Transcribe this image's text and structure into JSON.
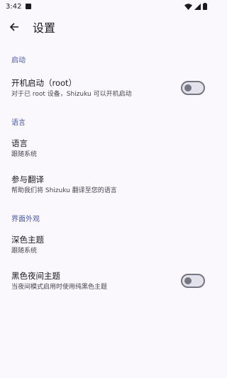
{
  "status_bar": {
    "time": "3:42"
  },
  "app_bar": {
    "title": "设置"
  },
  "sections": {
    "startup": {
      "header": "启动",
      "root_start": {
        "title": "开机启动（root）",
        "subtitle": "对于已 root 设备，Shizuku 可以开机启动",
        "switch_on": false
      }
    },
    "language": {
      "header": "语言",
      "language_item": {
        "title": "语言",
        "subtitle": "跟随系统"
      },
      "translate_item": {
        "title": "参与翻译",
        "subtitle": "帮助我们将 Shizuku 翻译至您的语言"
      }
    },
    "appearance": {
      "header": "界面外观",
      "dark_theme": {
        "title": "深色主题",
        "subtitle": "跟随系统"
      },
      "black_theme": {
        "title": "黑色夜间主题",
        "subtitle": "当夜间模式启用时使用纯黑色主题",
        "switch_on": false
      }
    }
  },
  "colors": {
    "section_header": "#4a58a8",
    "background": "#fbf8fd",
    "switch_outline": "#767680"
  }
}
